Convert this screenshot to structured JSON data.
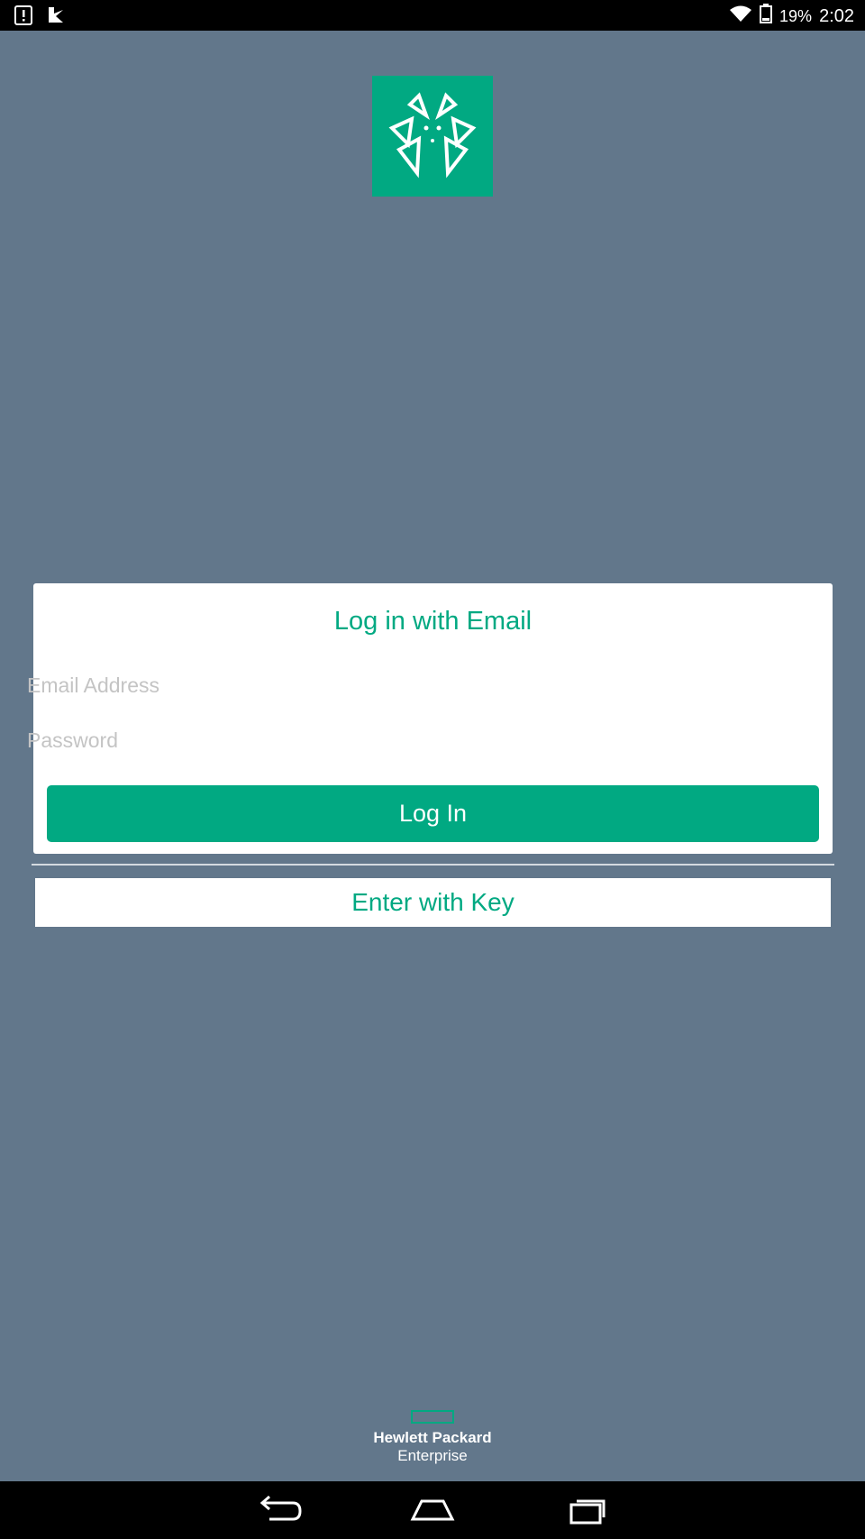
{
  "status_bar": {
    "battery_percent": "19%",
    "time": "2:02",
    "icons": [
      "alert-icon",
      "notification-app-icon",
      "wifi-icon",
      "battery-icon"
    ]
  },
  "app": {
    "logo_icon": "app-logo-icon",
    "brand_color": "#01a982",
    "background_color": "#62778b"
  },
  "login": {
    "title": "Log in with Email",
    "email_placeholder": "Email Address",
    "email_value": "",
    "password_placeholder": "Password",
    "password_value": "",
    "login_button": "Log In"
  },
  "key_button": "Enter with Key",
  "brand": {
    "line1": "Hewlett Packard",
    "line2": "Enterprise"
  },
  "nav": {
    "icons": [
      "back-icon",
      "home-icon",
      "recents-icon"
    ]
  }
}
